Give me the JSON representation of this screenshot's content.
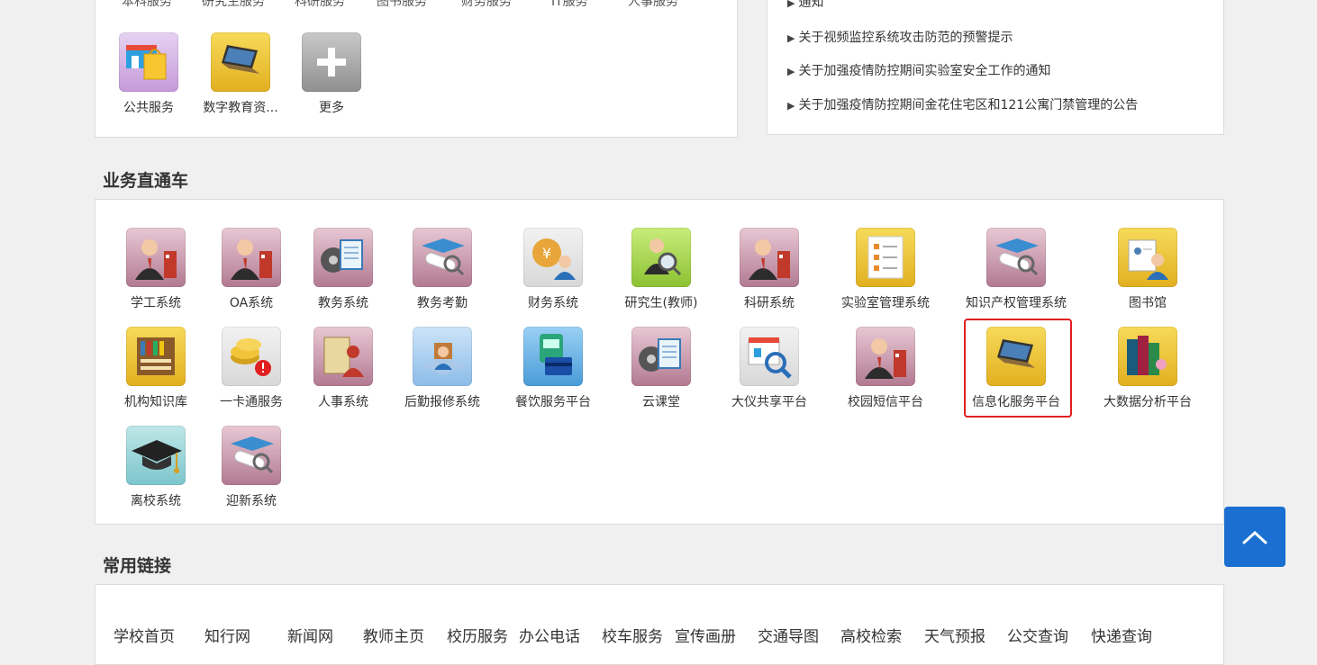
{
  "top_services": {
    "partial_row": [
      "本科服务",
      "研究生服务",
      "科研服务",
      "图书服务",
      "财务服务",
      "IT服务",
      "人事服务"
    ],
    "items": [
      {
        "label": "公共服务",
        "icon": "shopping-bag-icon"
      },
      {
        "label": "数字教育资...",
        "icon": "laptop-icon"
      },
      {
        "label": "更多",
        "icon": "plus-icon"
      }
    ]
  },
  "notices": {
    "partial_item": "通知",
    "items": [
      "关于视频监控系统攻击防范的预警提示",
      "关于加强疫情防控期间实验室安全工作的通知",
      "关于加强疫情防控期间金花住宅区和121公寓门禁管理的公告"
    ]
  },
  "business": {
    "title": "业务直通车",
    "items": [
      {
        "label": "学工系统",
        "icon": "businessman-folder-icon"
      },
      {
        "label": "OA系统",
        "icon": "businessman-folder-icon"
      },
      {
        "label": "教务系统",
        "icon": "film-clipboard-icon"
      },
      {
        "label": "教务考勤",
        "icon": "graduation-scroll-icon"
      },
      {
        "label": "财务系统",
        "icon": "coin-user-icon"
      },
      {
        "label": "研究生(教师)",
        "icon": "user-magnifier-icon"
      },
      {
        "label": "科研系统",
        "icon": "businessman-folder-icon"
      },
      {
        "label": "实验室管理系统",
        "icon": "document-list-icon"
      },
      {
        "label": "知识产权管理系统",
        "icon": "graduation-scroll-icon"
      },
      {
        "label": "图书馆",
        "icon": "id-card-user-icon"
      },
      {
        "label": "机构知识库",
        "icon": "bookshelf-icon"
      },
      {
        "label": "一卡通服务",
        "icon": "coin-alert-icon"
      },
      {
        "label": "人事系统",
        "icon": "person-book-icon"
      },
      {
        "label": "后勤报修系统",
        "icon": "worker-box-icon"
      },
      {
        "label": "餐饮服务平台",
        "icon": "train-card-icon"
      },
      {
        "label": "云课堂",
        "icon": "film-clipboard-icon"
      },
      {
        "label": "大仪共享平台",
        "icon": "store-magnifier-icon"
      },
      {
        "label": "校园短信平台",
        "icon": "businessman-folder-icon"
      },
      {
        "label": "信息化服务平台",
        "icon": "laptop-icon"
      },
      {
        "label": "大数据分析平台",
        "icon": "book-stack-icon"
      },
      {
        "label": "离校系统",
        "icon": "graduation-cap-icon"
      },
      {
        "label": "迎新系统",
        "icon": "graduation-scroll-icon"
      }
    ]
  },
  "links": {
    "title": "常用链接",
    "items": [
      "学校首页",
      "知行网",
      "新闻网",
      "教师主页",
      "校历服务",
      "办公电话",
      "校车服务",
      "宣传画册",
      "交通导图",
      "高校检索",
      "天气预报",
      "公交查询",
      "快递查询"
    ]
  },
  "colors": {
    "accent_blue": "#1a6fd1",
    "highlight_red": "#e02020",
    "bg": "#f0f0f0"
  }
}
